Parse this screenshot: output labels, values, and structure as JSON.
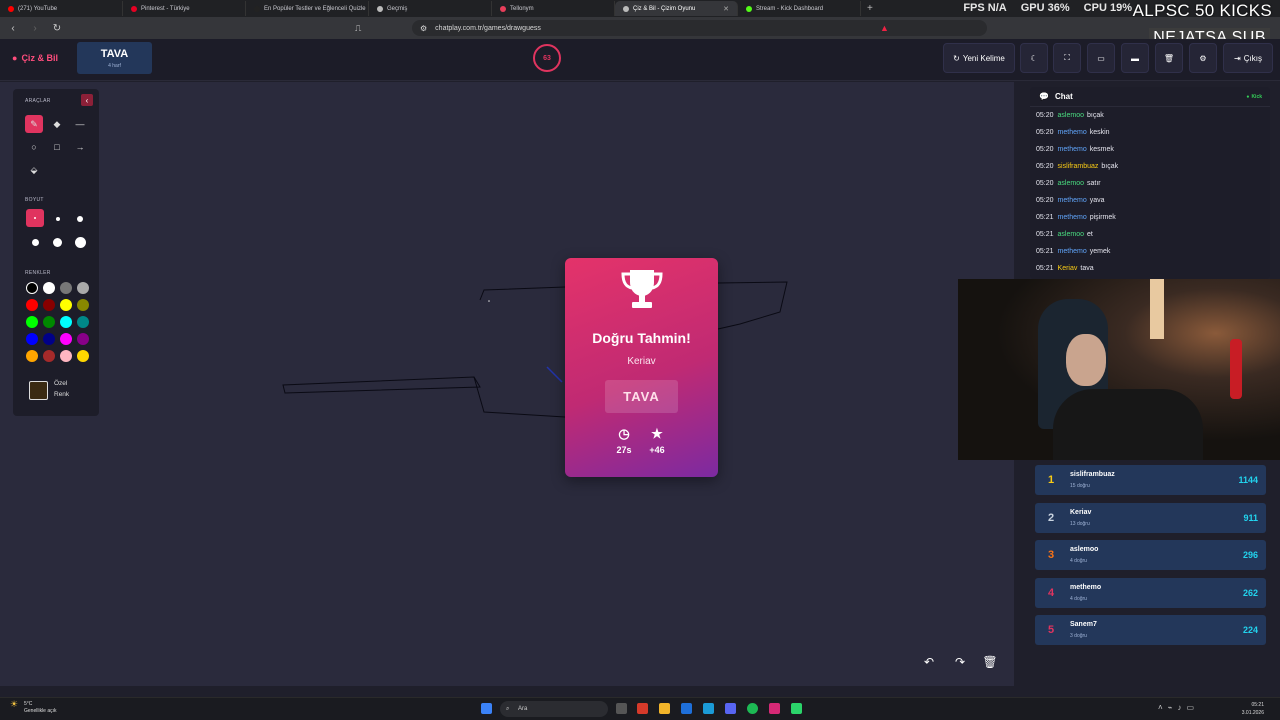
{
  "browser": {
    "tabs": [
      {
        "title": "(271) YouTube",
        "color": "#ff0000"
      },
      {
        "title": "Pinterest - Türkiye",
        "color": "#e60023"
      },
      {
        "title": "En Popüler Testler ve Eğlenceli Quizle",
        "color": "#222222"
      },
      {
        "title": "Geçmiş",
        "color": "#bbbbbb"
      },
      {
        "title": "Tellonym",
        "color": "#e83e5a"
      },
      {
        "title": "Çiz & Bil - Çizim Oyunu",
        "color": "#bbbbbb",
        "active": true
      },
      {
        "title": "Stream - Kick Dashboard",
        "color": "#53fc18"
      }
    ],
    "url": "chatplay.com.tr/games/drawguess",
    "perf": {
      "fps_label": "FPS",
      "fps_value": "N/A",
      "gpu_label": "GPU",
      "gpu_value": "36%",
      "cpu_label": "CPU",
      "cpu_value": "19%"
    },
    "overlay_title": "ALPSC 50 KICKS",
    "overlay_sub": "NEJATSA SUB"
  },
  "header": {
    "logo": "Çiz & Bil",
    "word": "TAVA",
    "word_hint": "4 harf",
    "timer": "63",
    "new_word": "Yeni Kelime",
    "exit": "Çıkış"
  },
  "tools": {
    "tools_label": "ARAÇLAR",
    "size_label": "BOYUT",
    "colors_label": "RENKLER",
    "custom_color_line1": "Özel",
    "custom_color_line2": "Renk",
    "colors": [
      "#000000",
      "#ffffff",
      "#777777",
      "#aaaaaa",
      "#ff0000",
      "#880000",
      "#ffff00",
      "#888800",
      "#00ff00",
      "#008800",
      "#00ffff",
      "#008888",
      "#0000ff",
      "#000088",
      "#ff00ff",
      "#880088",
      "#ffa500",
      "#a52a2a",
      "#ffb6c1",
      "#ffd700"
    ]
  },
  "result": {
    "title": "Doğru Tahmin!",
    "player": "Keriav",
    "word": "TAVA",
    "time": "27s",
    "points": "+46"
  },
  "chat": {
    "title": "Chat",
    "source": "Kick",
    "messages": [
      {
        "time": "05:20",
        "user": "aslemoo",
        "text": "bıçak",
        "color": "#4ade80"
      },
      {
        "time": "05:20",
        "user": "methemo",
        "text": "keskin",
        "color": "#60a5fa"
      },
      {
        "time": "05:20",
        "user": "methemo",
        "text": "kesmek",
        "color": "#60a5fa"
      },
      {
        "time": "05:20",
        "user": "sisliframbuaz",
        "text": "bıçak",
        "color": "#facc15"
      },
      {
        "time": "05:20",
        "user": "aslemoo",
        "text": "satır",
        "color": "#4ade80"
      },
      {
        "time": "05:20",
        "user": "methemo",
        "text": "yava",
        "color": "#60a5fa"
      },
      {
        "time": "05:21",
        "user": "methemo",
        "text": "pişirmek",
        "color": "#60a5fa"
      },
      {
        "time": "05:21",
        "user": "aslemoo",
        "text": "et",
        "color": "#4ade80"
      },
      {
        "time": "05:21",
        "user": "methemo",
        "text": "yemek",
        "color": "#60a5fa"
      },
      {
        "time": "05:21",
        "user": "Keriav",
        "text": "tava",
        "color": "#facc15"
      }
    ]
  },
  "leaderboard": [
    {
      "rank": "1",
      "name": "sisliframbuaz",
      "sub": "15 doğru",
      "score": "1144",
      "color": "#facc15"
    },
    {
      "rank": "2",
      "name": "Keriav",
      "sub": "13 doğru",
      "score": "911",
      "color": "#cbd5e1"
    },
    {
      "rank": "3",
      "name": "aslemoo",
      "sub": "4 doğru",
      "score": "296",
      "color": "#f97316"
    },
    {
      "rank": "4",
      "name": "methemo",
      "sub": "4 doğru",
      "score": "262",
      "color": "#e0345f"
    },
    {
      "rank": "5",
      "name": "Sanem7",
      "sub": "3 doğru",
      "score": "224",
      "color": "#e0345f"
    }
  ],
  "taskbar": {
    "weather_temp": "5°C",
    "weather_desc": "Genellikle açık",
    "search": "Ara",
    "time": "05:21",
    "date": "3.01.2026"
  }
}
